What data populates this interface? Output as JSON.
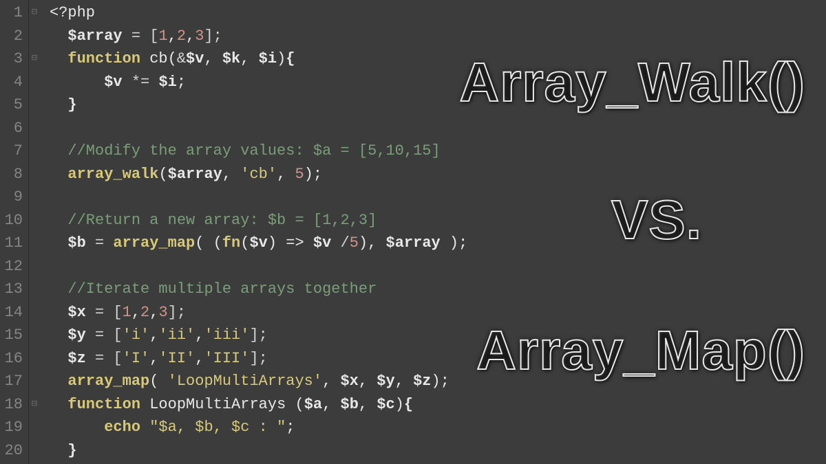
{
  "overlay": {
    "title1": "Array_Walk()",
    "title2": "VS.",
    "title3": "Array_Map()"
  },
  "lines": [
    {
      "n": "1",
      "fold": "⊟",
      "tokens": [
        [
          "tag",
          "<?php"
        ]
      ]
    },
    {
      "n": "2",
      "fold": "",
      "tokens": [
        [
          "op",
          "  "
        ],
        [
          "var",
          "$array"
        ],
        [
          "op",
          " = ["
        ],
        [
          "num",
          "1"
        ],
        [
          "punct",
          ","
        ],
        [
          "num",
          "2"
        ],
        [
          "punct",
          ","
        ],
        [
          "num",
          "3"
        ],
        [
          "op",
          "];"
        ]
      ]
    },
    {
      "n": "3",
      "fold": "⊟",
      "tokens": [
        [
          "op",
          "  "
        ],
        [
          "kw",
          "function"
        ],
        [
          "op",
          " "
        ],
        [
          "fn-name",
          "cb"
        ],
        [
          "punct",
          "("
        ],
        [
          "op",
          "&"
        ],
        [
          "var",
          "$v"
        ],
        [
          "punct",
          ", "
        ],
        [
          "var",
          "$k"
        ],
        [
          "punct",
          ", "
        ],
        [
          "var",
          "$i"
        ],
        [
          "punct",
          ")"
        ],
        [
          "brace",
          "{"
        ]
      ]
    },
    {
      "n": "4",
      "fold": "",
      "tokens": [
        [
          "op",
          "      "
        ],
        [
          "var",
          "$v"
        ],
        [
          "op",
          " *= "
        ],
        [
          "var",
          "$i"
        ],
        [
          "punct",
          ";"
        ]
      ]
    },
    {
      "n": "5",
      "fold": "",
      "tokens": [
        [
          "op",
          "  "
        ],
        [
          "brace",
          "}"
        ]
      ]
    },
    {
      "n": "6",
      "fold": "",
      "tokens": [
        [
          "op",
          ""
        ]
      ]
    },
    {
      "n": "7",
      "fold": "",
      "tokens": [
        [
          "op",
          "  "
        ],
        [
          "comment",
          "//Modify the array values: $a = [5,10,15]"
        ]
      ]
    },
    {
      "n": "8",
      "fold": "",
      "tokens": [
        [
          "op",
          "  "
        ],
        [
          "call",
          "array_walk"
        ],
        [
          "punct",
          "("
        ],
        [
          "var",
          "$array"
        ],
        [
          "punct",
          ", "
        ],
        [
          "str",
          "'cb'"
        ],
        [
          "punct",
          ", "
        ],
        [
          "num",
          "5"
        ],
        [
          "punct",
          ");"
        ]
      ]
    },
    {
      "n": "9",
      "fold": "",
      "tokens": [
        [
          "op",
          ""
        ]
      ]
    },
    {
      "n": "10",
      "fold": "",
      "tokens": [
        [
          "op",
          "  "
        ],
        [
          "comment",
          "//Return a new array: $b = [1,2,3]"
        ]
      ]
    },
    {
      "n": "11",
      "fold": "",
      "tokens": [
        [
          "op",
          "  "
        ],
        [
          "var",
          "$b"
        ],
        [
          "op",
          " = "
        ],
        [
          "call",
          "array_map"
        ],
        [
          "punct",
          "( ("
        ],
        [
          "kw",
          "fn"
        ],
        [
          "punct",
          "("
        ],
        [
          "var",
          "$v"
        ],
        [
          "punct",
          ") => "
        ],
        [
          "var",
          "$v"
        ],
        [
          "op",
          " /"
        ],
        [
          "num",
          "5"
        ],
        [
          "punct",
          "), "
        ],
        [
          "var",
          "$array"
        ],
        [
          "punct",
          " );"
        ]
      ]
    },
    {
      "n": "12",
      "fold": "",
      "tokens": [
        [
          "op",
          ""
        ]
      ]
    },
    {
      "n": "13",
      "fold": "",
      "tokens": [
        [
          "op",
          "  "
        ],
        [
          "comment",
          "//Iterate multiple arrays together"
        ]
      ]
    },
    {
      "n": "14",
      "fold": "",
      "tokens": [
        [
          "op",
          "  "
        ],
        [
          "var",
          "$x"
        ],
        [
          "op",
          " = ["
        ],
        [
          "num",
          "1"
        ],
        [
          "punct",
          ","
        ],
        [
          "num",
          "2"
        ],
        [
          "punct",
          ","
        ],
        [
          "num",
          "3"
        ],
        [
          "op",
          "];"
        ]
      ]
    },
    {
      "n": "15",
      "fold": "",
      "tokens": [
        [
          "op",
          "  "
        ],
        [
          "var",
          "$y"
        ],
        [
          "op",
          " = ["
        ],
        [
          "str",
          "'i'"
        ],
        [
          "punct",
          ","
        ],
        [
          "str",
          "'ii'"
        ],
        [
          "punct",
          ","
        ],
        [
          "str",
          "'iii'"
        ],
        [
          "op",
          "];"
        ]
      ]
    },
    {
      "n": "16",
      "fold": "",
      "tokens": [
        [
          "op",
          "  "
        ],
        [
          "var",
          "$z"
        ],
        [
          "op",
          " = ["
        ],
        [
          "str",
          "'I'"
        ],
        [
          "punct",
          ","
        ],
        [
          "str",
          "'II'"
        ],
        [
          "punct",
          ","
        ],
        [
          "str",
          "'III'"
        ],
        [
          "op",
          "];"
        ]
      ]
    },
    {
      "n": "17",
      "fold": "",
      "tokens": [
        [
          "op",
          "  "
        ],
        [
          "call",
          "array_map"
        ],
        [
          "punct",
          "( "
        ],
        [
          "str",
          "'LoopMultiArrays'"
        ],
        [
          "punct",
          ", "
        ],
        [
          "var",
          "$x"
        ],
        [
          "punct",
          ", "
        ],
        [
          "var",
          "$y"
        ],
        [
          "punct",
          ", "
        ],
        [
          "var",
          "$z"
        ],
        [
          "punct",
          ");"
        ]
      ]
    },
    {
      "n": "18",
      "fold": "⊟",
      "tokens": [
        [
          "op",
          "  "
        ],
        [
          "kw",
          "function"
        ],
        [
          "op",
          " "
        ],
        [
          "fn-name",
          "LoopMultiArrays"
        ],
        [
          "op",
          " "
        ],
        [
          "punct",
          "("
        ],
        [
          "var",
          "$a"
        ],
        [
          "punct",
          ", "
        ],
        [
          "var",
          "$b"
        ],
        [
          "punct",
          ", "
        ],
        [
          "var",
          "$c"
        ],
        [
          "punct",
          ")"
        ],
        [
          "brace",
          "{"
        ]
      ]
    },
    {
      "n": "19",
      "fold": "",
      "tokens": [
        [
          "op",
          "      "
        ],
        [
          "kw",
          "echo"
        ],
        [
          "op",
          " "
        ],
        [
          "str",
          "\"$a, $b, $c : \""
        ],
        [
          "punct",
          ";"
        ]
      ]
    },
    {
      "n": "20",
      "fold": "",
      "tokens": [
        [
          "op",
          "  "
        ],
        [
          "brace",
          "}"
        ]
      ]
    }
  ]
}
